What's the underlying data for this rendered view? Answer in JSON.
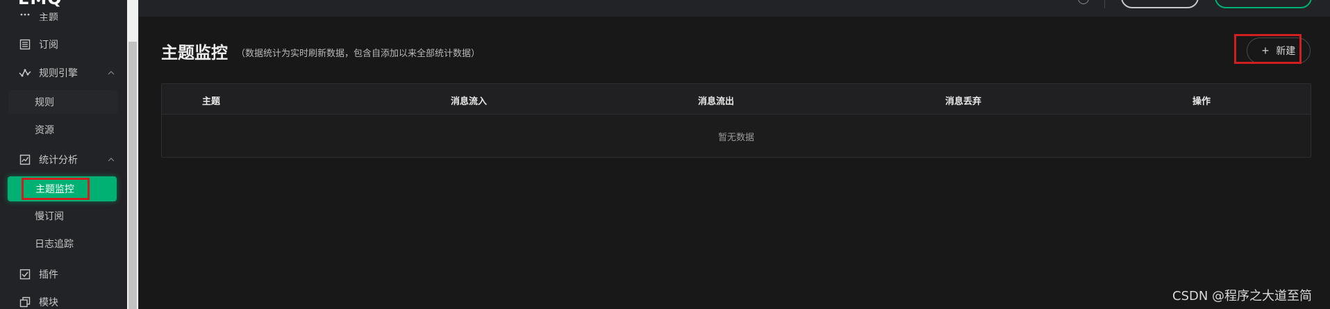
{
  "sidebar": {
    "logo": "EMQ",
    "top_partial_label": "主题",
    "items": [
      {
        "label": "订阅",
        "icon": "list-icon"
      },
      {
        "label": "规则引擎",
        "icon": "rule-engine-icon",
        "expanded": true
      },
      {
        "label": "统计分析",
        "icon": "chart-line-icon",
        "expanded": true
      },
      {
        "label": "插件",
        "icon": "checkbox-icon"
      },
      {
        "label": "模块",
        "icon": "module-icon"
      }
    ],
    "rule_sub": [
      "规则",
      "资源"
    ],
    "stats_sub": [
      "主题监控",
      "慢订阅",
      "日志追踪"
    ],
    "active_item": "主题监控"
  },
  "main": {
    "title": "主题监控",
    "subtitle": "（数据统计为实时刷新数据，包含自添加以来全部统计数据）",
    "new_button": "新建",
    "table": {
      "columns": [
        "主题",
        "消息流入",
        "消息流出",
        "消息丢弃",
        "操作"
      ],
      "empty_text": "暂无数据"
    }
  },
  "watermark": "CSDN @程序之大道至简",
  "colors": {
    "accent": "#00b173",
    "background": "#181818",
    "sidebar": "#222326",
    "highlight": "#d01f1f"
  }
}
